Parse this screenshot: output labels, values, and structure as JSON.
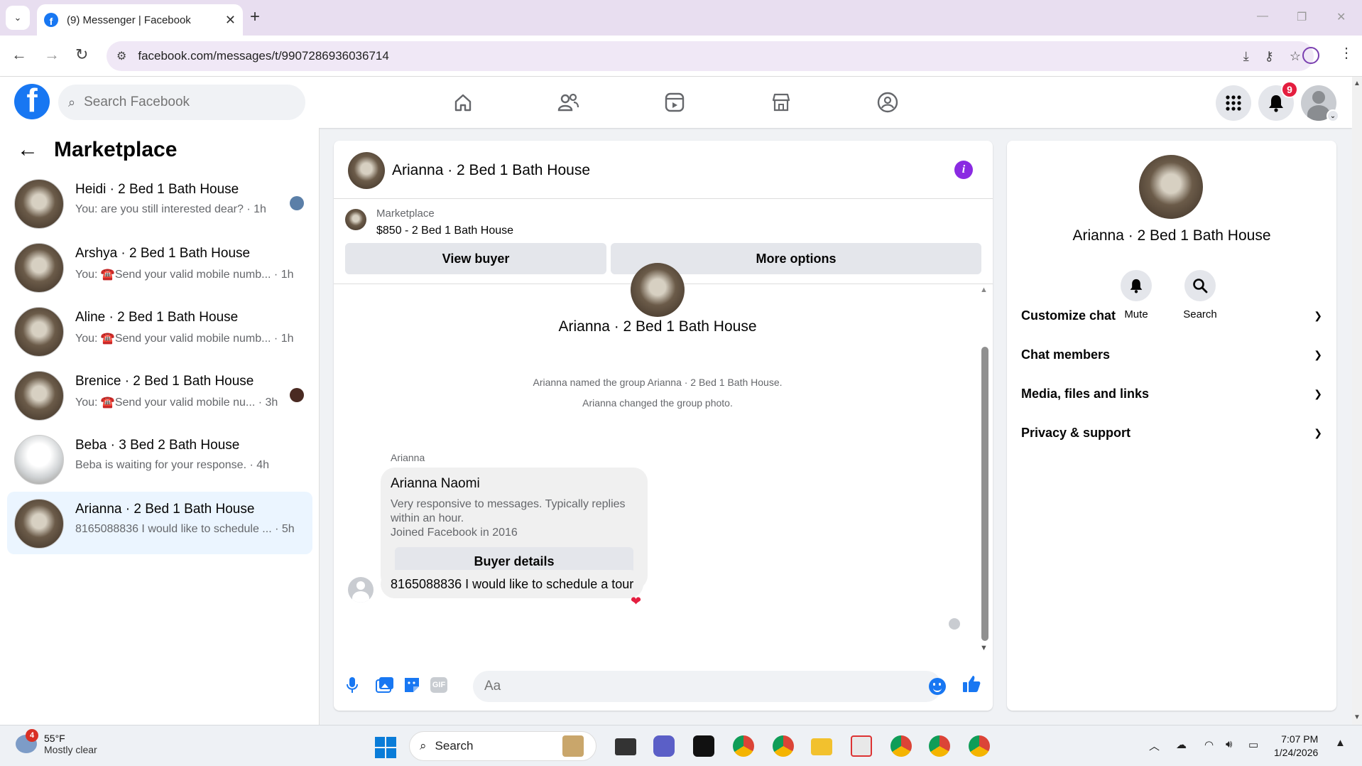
{
  "browser": {
    "tab_title": "(9) Messenger | Facebook",
    "url": "facebook.com/messages/t/9907286936036714"
  },
  "fb": {
    "search_placeholder": "Search Facebook",
    "notification_count": "9"
  },
  "left": {
    "title": "Marketplace",
    "conversations": [
      {
        "name": "Heidi · 2 Bed 1 Bath House",
        "preview": "You: are you still interested dear? · 1h"
      },
      {
        "name": "Arshya · 2 Bed 1 Bath House",
        "preview": "You: ☎️Send your valid mobile numb... · 1h"
      },
      {
        "name": "Aline · 2 Bed 1 Bath House",
        "preview": "You: ☎️Send your valid mobile numb... · 1h"
      },
      {
        "name": "Brenice · 2 Bed 1 Bath House",
        "preview": "You: ☎️Send your valid mobile nu... · 3h"
      },
      {
        "name": "Beba · 3 Bed 2 Bath House",
        "preview": "Beba is waiting for your response. · 4h"
      },
      {
        "name": "Arianna · 2 Bed 1 Bath House",
        "preview": "8165088836 I would like to schedule ... · 5h"
      }
    ]
  },
  "chat": {
    "title": "Arianna · 2 Bed 1 Bath House",
    "marketplace_label": "Marketplace",
    "listing": "$850 - 2 Bed 1 Bath House",
    "view_buyer": "View buyer",
    "more_options": "More options",
    "thread_name": "Arianna · 2 Bed 1 Bath House",
    "system_messages": [
      "Arianna named the group Arianna · 2 Bed 1 Bath House.",
      "Arianna changed the group photo."
    ],
    "sender": "Arianna",
    "profile_card": {
      "name": "Arianna Naomi",
      "desc1": "Very responsive to messages. Typically replies within an hour.",
      "desc2": "Joined Facebook in 2016",
      "button": "Buyer details"
    },
    "message": "8165088836 I would like to schedule a tour",
    "composer_placeholder": "Aa"
  },
  "right": {
    "title": "Arianna · 2 Bed 1 Bath House",
    "mute": "Mute",
    "search": "Search",
    "sections": [
      "Customize chat",
      "Chat members",
      "Media, files and links",
      "Privacy & support"
    ]
  },
  "taskbar": {
    "weather_badge": "4",
    "temp": "55°F",
    "weather": "Mostly clear",
    "search": "Search",
    "time": "7:07 PM",
    "date": "1/24/2026"
  }
}
